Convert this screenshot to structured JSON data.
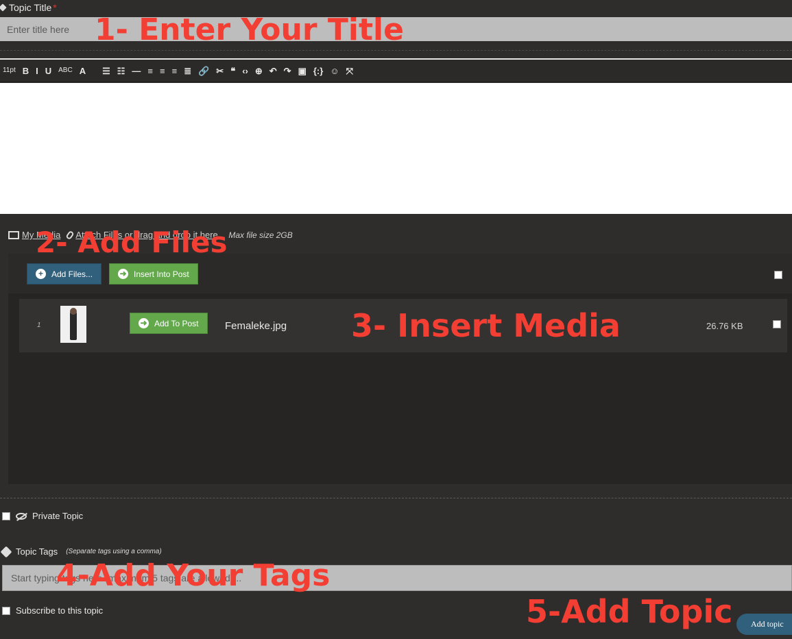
{
  "title_field": {
    "label": "Topic Title",
    "required_mark": "*",
    "placeholder": "Enter title here"
  },
  "toolbar": {
    "font_size": "11pt",
    "items": [
      {
        "icon": "bold-icon",
        "glyph": "B"
      },
      {
        "icon": "italic-icon",
        "glyph": "I"
      },
      {
        "icon": "underline-icon",
        "glyph": "U"
      },
      {
        "icon": "strikethrough-icon",
        "glyph": "ABC"
      },
      {
        "icon": "text-color-icon",
        "glyph": "A"
      },
      {
        "icon": "bullet-list-icon",
        "glyph": "☰"
      },
      {
        "icon": "numbered-list-icon",
        "glyph": "☷"
      },
      {
        "icon": "horizontal-rule-icon",
        "glyph": "—"
      },
      {
        "icon": "align-left-icon",
        "glyph": "≡"
      },
      {
        "icon": "align-center-icon",
        "glyph": "≡"
      },
      {
        "icon": "align-right-icon",
        "glyph": "≡"
      },
      {
        "icon": "align-justify-icon",
        "glyph": "≣"
      },
      {
        "icon": "link-icon",
        "glyph": "🔗"
      },
      {
        "icon": "unlink-icon",
        "glyph": "✂"
      },
      {
        "icon": "blockquote-icon",
        "glyph": "❝"
      },
      {
        "icon": "code-icon",
        "glyph": "‹›"
      },
      {
        "icon": "insert-icon",
        "glyph": "⊕"
      },
      {
        "icon": "undo-icon",
        "glyph": "↶"
      },
      {
        "icon": "redo-icon",
        "glyph": "↷"
      },
      {
        "icon": "paste-icon",
        "glyph": "▣"
      },
      {
        "icon": "shortcode-icon",
        "glyph": "{:}"
      },
      {
        "icon": "emoji-icon",
        "glyph": "☺"
      },
      {
        "icon": "fullscreen-icon",
        "glyph": "⤧"
      }
    ]
  },
  "media": {
    "my_media_link": "My Media",
    "attach_text": "Attach Files or drag and drop it here.",
    "max_size_hint": "Max file size 2GB",
    "add_files_label": "Add Files...",
    "insert_into_post_label": "Insert Into Post",
    "files": [
      {
        "index": "1",
        "add_to_post_label": "Add To Post",
        "name": "Femaleke.jpg",
        "size": "26.76 KB"
      }
    ]
  },
  "options": {
    "private_topic_label": "Private Topic",
    "topic_tags_label": "Topic Tags",
    "topic_tags_hint": "(Separate tags using a comma)",
    "tags_placeholder": "Start typing tags here (maximum 5 tags are allowed)...",
    "subscribe_label": "Subscribe to this topic"
  },
  "submit": {
    "add_topic_label": "Add topic"
  },
  "annotations": {
    "step1": "1- Enter Your Title",
    "step2": "2- Add Files",
    "step3": "3- Insert Media",
    "step4": "4-Add Your Tags",
    "step5": "5-Add Topic",
    "color": "#f23e33"
  },
  "colors": {
    "background": "#2e2d2c",
    "input_bg": "#bdbdbd",
    "blue_button": "#31607c",
    "green_button": "#63a94c"
  }
}
